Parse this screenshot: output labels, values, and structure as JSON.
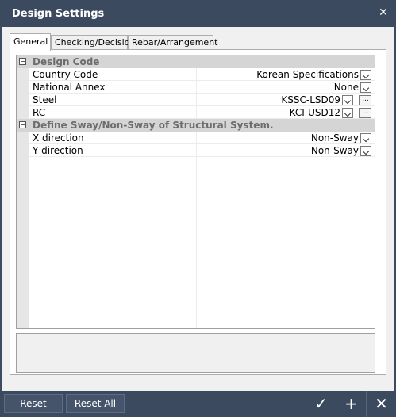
{
  "window": {
    "title": "Design Settings"
  },
  "tabs": [
    {
      "label": "General",
      "active": true
    },
    {
      "label": "Checking/Decision",
      "active": false
    },
    {
      "label": "Rebar/Arrangement",
      "active": false
    }
  ],
  "grid": {
    "categories": [
      {
        "label": "Design Code",
        "toggle": "−",
        "properties": [
          {
            "label": "Country Code",
            "value": "Korean Specifications"
          },
          {
            "label": "National Annex",
            "value": "None"
          },
          {
            "label": "Steel",
            "value": "KSSC-LSD09"
          },
          {
            "label": "RC",
            "value": "KCI-USD12"
          }
        ]
      },
      {
        "label": "Define Sway/Non-Sway of Structural System.",
        "toggle": "−",
        "properties": [
          {
            "label": "X direction",
            "value": "Non-Sway"
          },
          {
            "label": "Y direction",
            "value": "Non-Sway"
          }
        ]
      }
    ],
    "ellipsis_label": "..."
  },
  "footer": {
    "reset_label": "Reset",
    "reset_all_label": "Reset All",
    "ok_icon": "checkmark-icon",
    "add_icon": "plus-icon",
    "close_icon": "close-icon"
  },
  "colors": {
    "titlebar": "#3c4a5f",
    "category_bg": "#d5d5d5",
    "category_text": "#6d6d6d"
  }
}
